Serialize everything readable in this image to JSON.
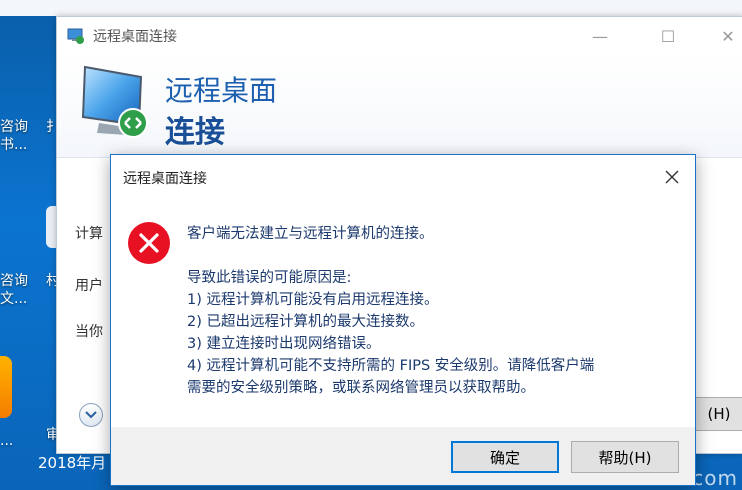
{
  "desktop": {
    "icon_labels": [
      {
        "line1": "咨询",
        "line2": "书..."
      },
      {
        "line1": "咨询",
        "line2": "文..."
      },
      {
        "line1": "...",
        "line2": ""
      }
    ],
    "clock_date": "2018年月",
    "watermark": "com"
  },
  "rdp_window": {
    "title": "远程桌面连接",
    "banner_line1": "远程桌面",
    "banner_line2": "连接",
    "labels": [
      "计算",
      "用户",
      "当你"
    ],
    "help_shortcut": "(H)"
  },
  "dialog": {
    "title": "远程桌面连接",
    "headline": "客户端无法建立与远程计算机的连接。",
    "reasons_heading": "导致此错误的可能原因是:",
    "reasons": [
      "1) 远程计算机可能没有启用远程连接。",
      "2) 已超出远程计算机的最大连接数。",
      "3) 建立连接时出现网络错误。",
      "4) 远程计算机可能不支持所需的 FIPS 安全级别。请降低客户端",
      "需要的安全级别策略，或联系网络管理员以获取帮助。"
    ],
    "ok_label": "确定",
    "help_label": "帮助(H)"
  },
  "colors": {
    "error_red": "#e81123",
    "dialog_border": "#1a72c6",
    "banner_blue": "#1e60b0"
  },
  "icons": [
    "remote-desktop-icon",
    "close-icon",
    "error-icon",
    "options-toggle-icon"
  ]
}
